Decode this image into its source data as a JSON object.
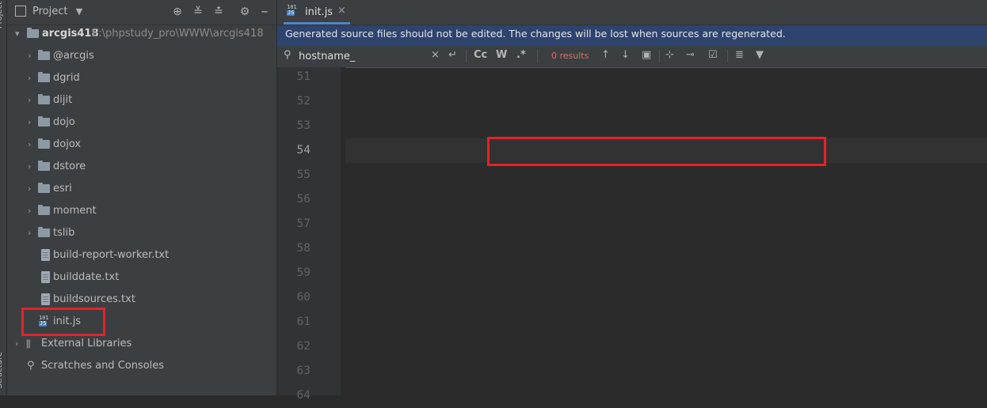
{
  "side_strip": {
    "top_label": "Project",
    "bottom_label": "Structure"
  },
  "project_panel": {
    "title": "Project",
    "root": {
      "name": "arcgis418",
      "path": "E:\\phpstudy_pro\\WWW\\arcgis418"
    },
    "folders": [
      "@arcgis",
      "dgrid",
      "dijit",
      "dojo",
      "dojox",
      "dstore",
      "esri",
      "moment",
      "tslib"
    ],
    "files": [
      "build-report-worker.txt",
      "builddate.txt",
      "buildsources.txt"
    ],
    "highlighted_file": {
      "name": "init.js",
      "icon_top": "101",
      "icon_bottom": "JS"
    },
    "external_libraries": "External Libraries",
    "scratches": "Scratches and Consoles"
  },
  "editor": {
    "tab": {
      "label": "init.js",
      "icon_top": "101",
      "icon_bottom": "JS"
    },
    "banner": "Generated source files should not be edited. The changes will be lost when sources are regenerated.",
    "find": {
      "query": "hostname_",
      "match_case": "Cc",
      "words": "W",
      "regex": ".*",
      "results": "0 results"
    },
    "current_line": "54",
    "line_numbers": [
      "51",
      "52",
      "53",
      "54",
      "55",
      "56",
      "57",
      "58",
      "59",
      "60",
      "61",
      "62",
      "63",
      "64"
    ]
  },
  "colors": {
    "highlight_box": "#e8202a",
    "banner_bg": "#2e436e",
    "results": "#e06c65"
  }
}
